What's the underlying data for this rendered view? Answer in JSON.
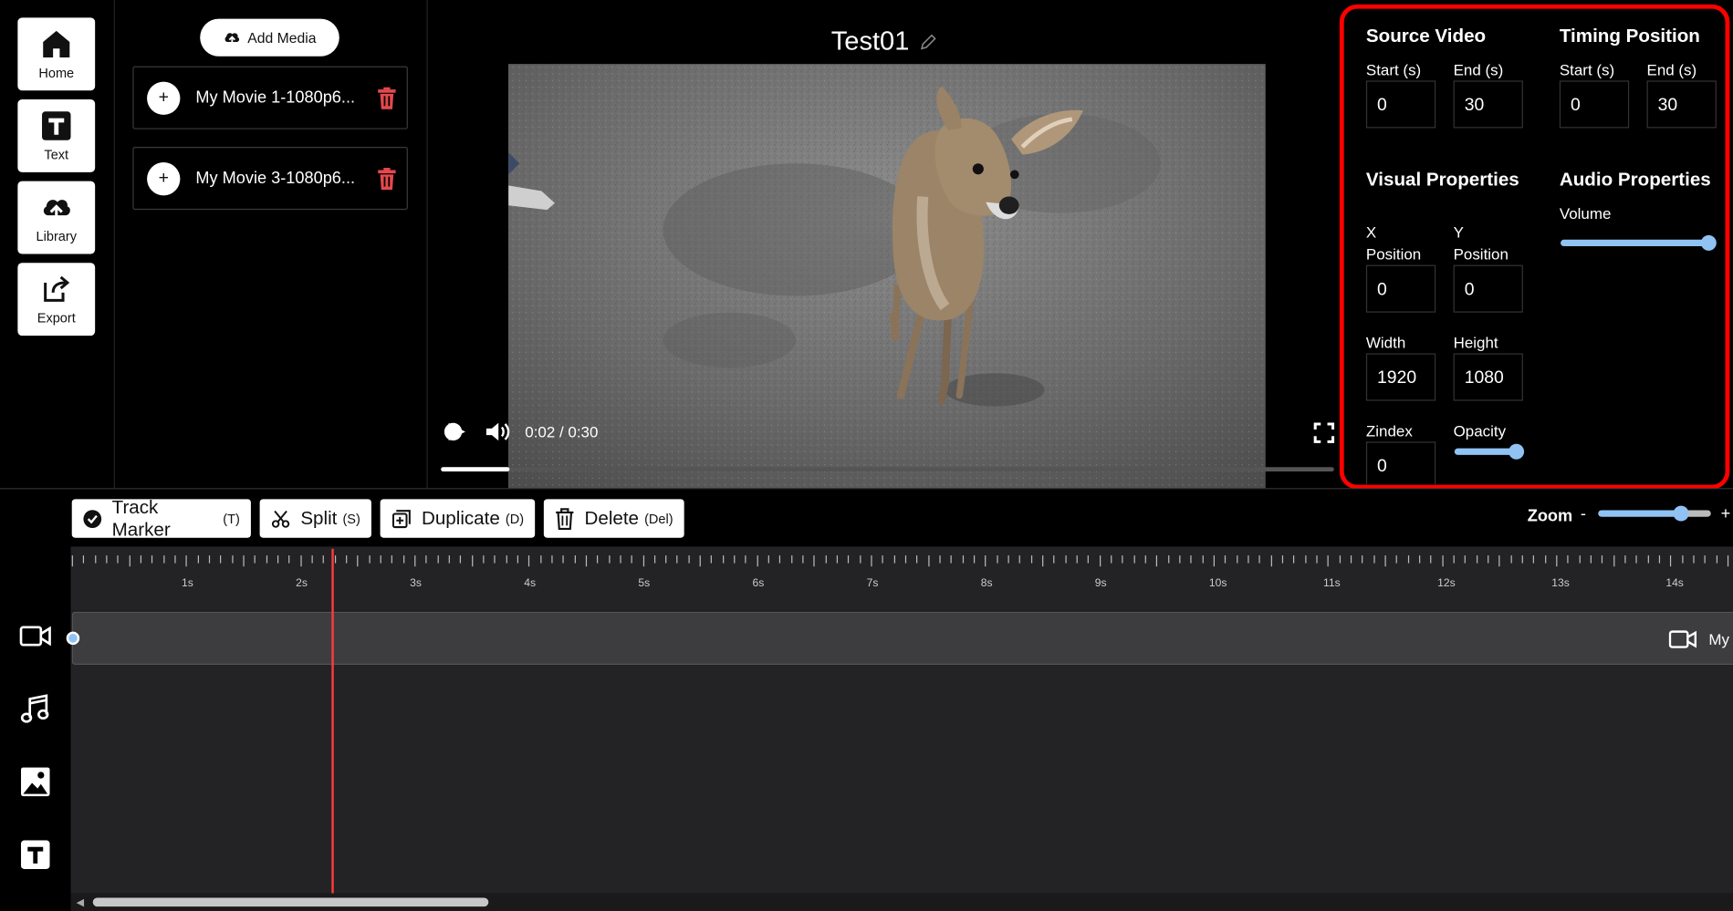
{
  "nav": {
    "home": "Home",
    "text": "Text",
    "library": "Library",
    "export": "Export"
  },
  "media": {
    "add_label": "Add Media",
    "items": [
      {
        "title": "My Movie 1-1080p6..."
      },
      {
        "title": "My Movie 3-1080p6..."
      }
    ]
  },
  "project": {
    "title": "Test01"
  },
  "player": {
    "time": "0:02 / 0:30",
    "progress_fraction": 0.077
  },
  "properties": {
    "source_video": {
      "heading": "Source Video",
      "start_label": "Start (s)",
      "start_value": "0",
      "end_label": "End (s)",
      "end_value": "30"
    },
    "timing_position": {
      "heading": "Timing Position",
      "start_label": "Start (s)",
      "start_value": "0",
      "end_label": "End (s)",
      "end_value": "30"
    },
    "visual": {
      "heading": "Visual Properties",
      "x_label_1": "X",
      "x_label_2": "Position",
      "x_value": "0",
      "y_label_1": "Y",
      "y_label_2": "Position",
      "y_value": "0",
      "width_label": "Width",
      "width_value": "1920",
      "height_label": "Height",
      "height_value": "1080",
      "zindex_label": "Zindex",
      "zindex_value": "0",
      "opacity_label": "Opacity",
      "opacity_level": 1.0
    },
    "audio": {
      "heading": "Audio Properties",
      "volume_label": "Volume",
      "volume_level": 1.0
    }
  },
  "toolbar": {
    "track_marker": "Track Marker",
    "track_marker_key": "(T)",
    "split": "Split",
    "split_key": "(S)",
    "duplicate": "Duplicate",
    "duplicate_key": "(D)",
    "delete": "Delete",
    "delete_key": "(Del)",
    "zoom_label": "Zoom",
    "zoom_minus": "-",
    "zoom_plus": "+",
    "zoom_level": 0.74
  },
  "timeline": {
    "tick_labels": [
      "1s",
      "2s",
      "3s",
      "4s",
      "5s",
      "6s",
      "7s",
      "8s",
      "9s",
      "10s",
      "11s",
      "12s",
      "13s",
      "14s"
    ],
    "playhead_seconds": 2.28,
    "clip_label": "My"
  },
  "colors": {
    "accent": "#90c3f3",
    "danger": "#e5484d",
    "playhead": "#ff3b3b",
    "highlight_box": "#ff0000"
  }
}
